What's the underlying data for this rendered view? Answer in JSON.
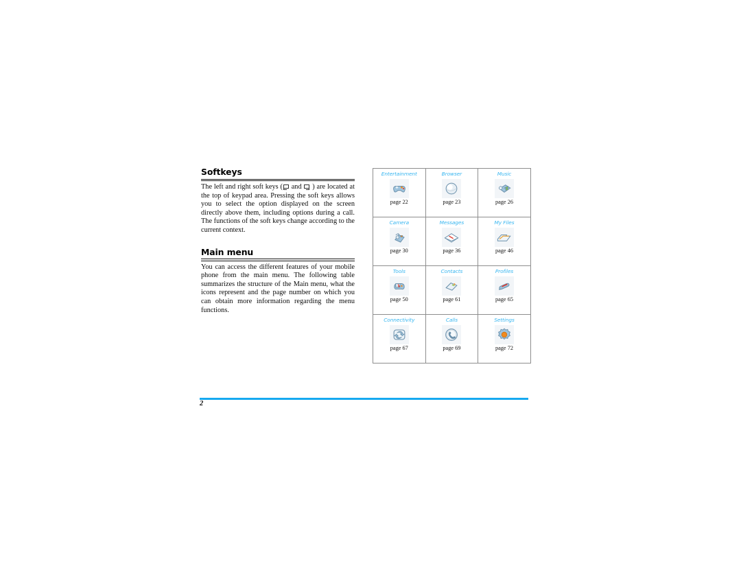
{
  "document": {
    "page_number": "2",
    "accent_color": "#16a9f0",
    "label_color": "#38b6f0",
    "table_border_color": "#8d8d8d"
  },
  "sections": [
    {
      "id": "softkeys",
      "heading": "Softkeys",
      "paragraph_before_glyphs": "The left and right soft keys (",
      "paragraph_between_glyphs": " and ",
      "paragraph_after_glyphs": " ) are located at the top of keypad area. Pressing the soft keys allows you to select the option displayed on the screen directly above them, including options during a call. The functions of the soft keys change according to the current context."
    },
    {
      "id": "main-menu",
      "heading": "Main menu",
      "paragraph": "You can access the different features of your mobile phone from the main menu. The following table summarizes the structure of the Main menu, what the icons represent and the page number on which you can obtain more information regarding the menu functions."
    }
  ],
  "menu_table": {
    "rows": [
      [
        {
          "label": "Entertainment",
          "page": "page 22",
          "icon": "gamepad-icon"
        },
        {
          "label": "Browser",
          "page": "page 23",
          "icon": "globe-icon"
        },
        {
          "label": "Music",
          "page": "page 26",
          "icon": "music-note-icon"
        }
      ],
      [
        {
          "label": "Camera",
          "page": "page 30",
          "icon": "camera-icon"
        },
        {
          "label": "Messages",
          "page": "page 36",
          "icon": "envelope-icon"
        },
        {
          "label": "My Files",
          "page": "page 46",
          "icon": "folder-icon"
        }
      ],
      [
        {
          "label": "Tools",
          "page": "page 50",
          "icon": "toolbox-icon"
        },
        {
          "label": "Contacts",
          "page": "page 61",
          "icon": "address-book-icon"
        },
        {
          "label": "Profiles",
          "page": "page 65",
          "icon": "profiles-brush-icon"
        }
      ],
      [
        {
          "label": "Connectivity",
          "page": "page 67",
          "icon": "connectivity-arrows-icon"
        },
        {
          "label": "Calls",
          "page": "page 69",
          "icon": "phone-handset-icon"
        },
        {
          "label": "Settings",
          "page": "page 72",
          "icon": "gear-icon"
        }
      ]
    ]
  }
}
